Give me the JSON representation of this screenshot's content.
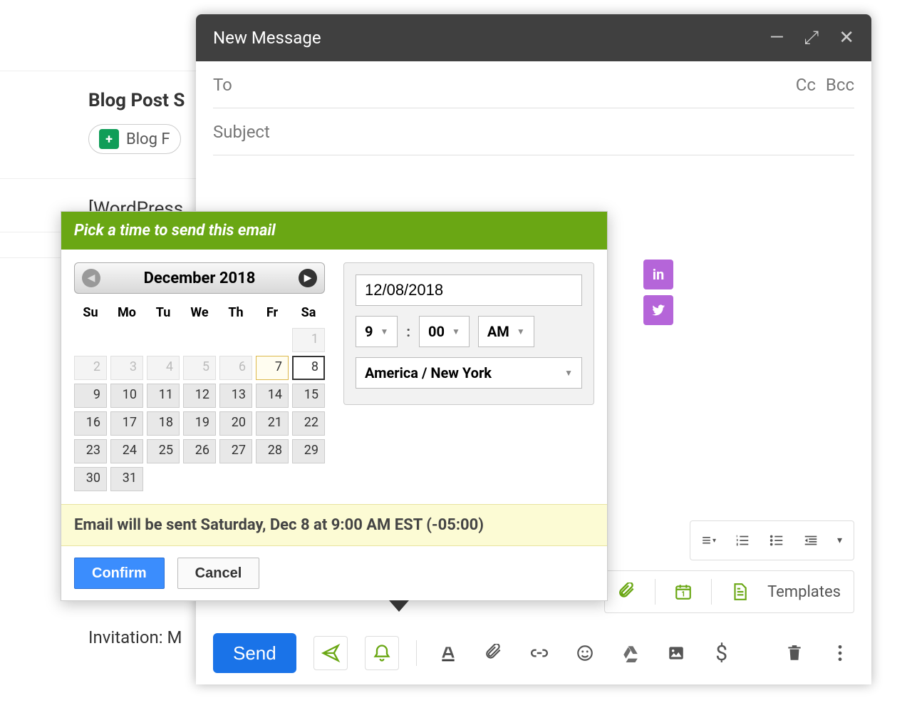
{
  "bg": {
    "heading": "Blog Post S",
    "chip_label": "Blog F",
    "wp_text": "[WordPress",
    "invite_text": "Invitation: M"
  },
  "compose": {
    "title": "New Message",
    "to_label": "To",
    "cc": "Cc",
    "bcc": "Bcc",
    "subject_label": "Subject",
    "send_label": "Send",
    "templates_label": "Templates"
  },
  "picker": {
    "header": "Pick a time to send this email",
    "month_label": "December 2018",
    "dow": [
      "Su",
      "Mo",
      "Tu",
      "We",
      "Th",
      "Fr",
      "Sa"
    ],
    "weeks": [
      [
        null,
        null,
        null,
        null,
        null,
        null,
        {
          "d": 1,
          "state": "disabled"
        }
      ],
      [
        {
          "d": 2,
          "state": "disabled"
        },
        {
          "d": 3,
          "state": "disabled"
        },
        {
          "d": 4,
          "state": "disabled"
        },
        {
          "d": 5,
          "state": "disabled"
        },
        {
          "d": 6,
          "state": "disabled"
        },
        {
          "d": 7,
          "state": "today"
        },
        {
          "d": 8,
          "state": "selected"
        }
      ],
      [
        {
          "d": 9
        },
        {
          "d": 10
        },
        {
          "d": 11
        },
        {
          "d": 12
        },
        {
          "d": 13
        },
        {
          "d": 14
        },
        {
          "d": 15
        }
      ],
      [
        {
          "d": 16
        },
        {
          "d": 17
        },
        {
          "d": 18
        },
        {
          "d": 19
        },
        {
          "d": 20
        },
        {
          "d": 21
        },
        {
          "d": 22
        }
      ],
      [
        {
          "d": 23
        },
        {
          "d": 24
        },
        {
          "d": 25
        },
        {
          "d": 26
        },
        {
          "d": 27
        },
        {
          "d": 28
        },
        {
          "d": 29
        }
      ],
      [
        {
          "d": 30
        },
        {
          "d": 31
        },
        null,
        null,
        null,
        null,
        null
      ]
    ],
    "date_value": "12/08/2018",
    "hour": "9",
    "minute": "00",
    "ampm": "AM",
    "timezone": "America / New York",
    "status": "Email will be sent Saturday, Dec 8 at 9:00 AM EST (-05:00)",
    "confirm": "Confirm",
    "cancel": "Cancel"
  }
}
